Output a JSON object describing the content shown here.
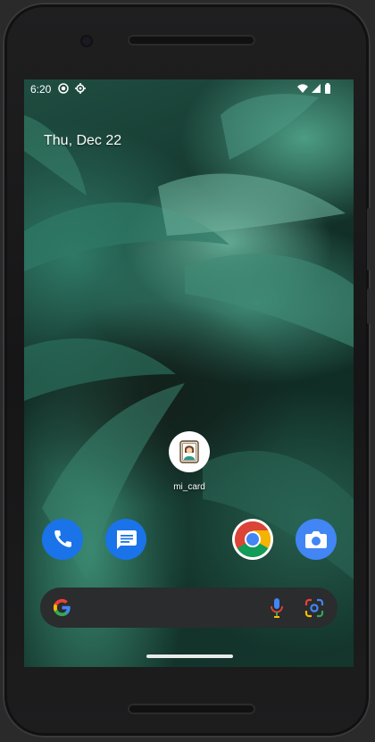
{
  "status_bar": {
    "time": "6:20",
    "left_icons": [
      "record-icon",
      "settings-gear-icon"
    ],
    "right_icons": [
      "wifi-icon",
      "cellular-signal-icon",
      "battery-icon"
    ]
  },
  "home": {
    "date": "Thu, Dec 22",
    "app": {
      "label": "mi_card",
      "icon": "person-card-icon"
    }
  },
  "dock": {
    "apps": [
      {
        "name": "Phone",
        "icon": "phone-icon",
        "color": "#1a73e8"
      },
      {
        "name": "Messages",
        "icon": "messages-icon",
        "color": "#1a73e8"
      },
      {
        "name": "Chrome",
        "icon": "chrome-icon",
        "color": "#ffffff"
      },
      {
        "name": "Camera",
        "icon": "camera-icon",
        "color": "#4285f4"
      }
    ]
  },
  "search_bar": {
    "icons": [
      "google-g-icon",
      "microphone-icon",
      "google-lens-icon"
    ]
  }
}
